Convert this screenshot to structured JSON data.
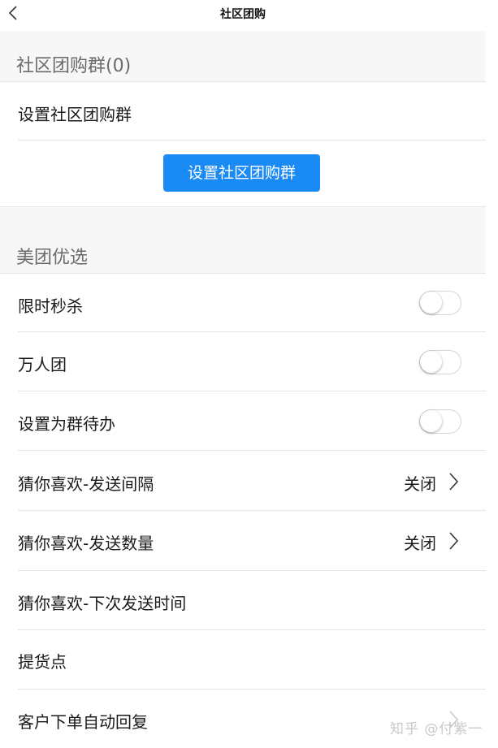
{
  "nav": {
    "title": "社区团购",
    "back_icon": "chevron-left-icon"
  },
  "community_section": {
    "header": "社区团购群(0)",
    "row_label": "设置社区团购群",
    "button_label": "设置社区团购群",
    "button_color": "#1a8af5"
  },
  "meituan_section": {
    "header": "美团优选",
    "rows": [
      {
        "label": "限时秒杀",
        "type": "toggle",
        "on": false
      },
      {
        "label": "万人团",
        "type": "toggle",
        "on": false
      },
      {
        "label": "设置为群待办",
        "type": "toggle",
        "on": false
      },
      {
        "label": "猜你喜欢-发送间隔",
        "type": "value",
        "value": "关闭"
      },
      {
        "label": "猜你喜欢-发送数量",
        "type": "value",
        "value": "关闭"
      },
      {
        "label": "猜你喜欢-下次发送时间",
        "type": "plain"
      },
      {
        "label": "提货点",
        "type": "plain"
      },
      {
        "label": "客户下单自动回复",
        "type": "chevron"
      }
    ]
  },
  "watermark": "知乎 @付紫一"
}
